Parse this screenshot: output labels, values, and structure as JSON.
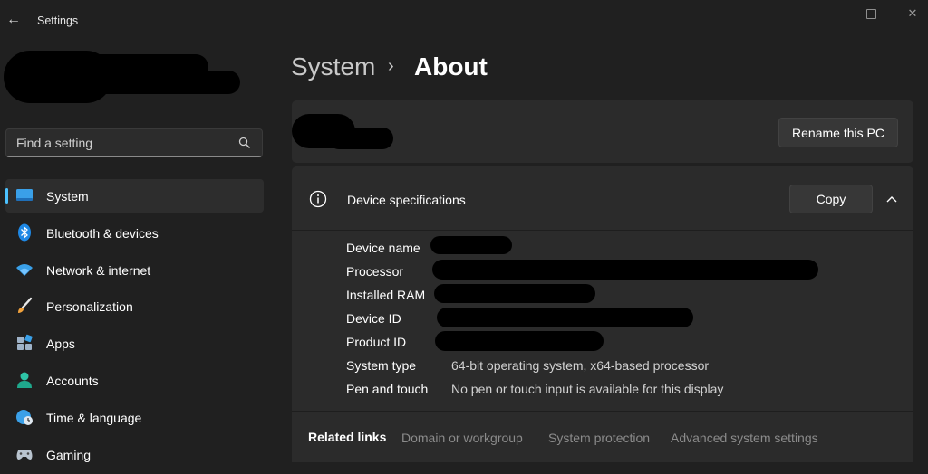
{
  "window": {
    "title": "Settings"
  },
  "search": {
    "placeholder": "Find a setting"
  },
  "sidebar": {
    "items": [
      {
        "label": "System",
        "icon": "monitor-icon",
        "active": true
      },
      {
        "label": "Bluetooth & devices",
        "icon": "bluetooth-icon"
      },
      {
        "label": "Network & internet",
        "icon": "wifi-icon"
      },
      {
        "label": "Personalization",
        "icon": "brush-icon"
      },
      {
        "label": "Apps",
        "icon": "apps-icon"
      },
      {
        "label": "Accounts",
        "icon": "person-icon"
      },
      {
        "label": "Time & language",
        "icon": "globe-clock-icon"
      },
      {
        "label": "Gaming",
        "icon": "gamepad-icon"
      }
    ]
  },
  "breadcrumb": {
    "parent": "System",
    "current": "About"
  },
  "pc_card": {
    "rename_label": "Rename this PC"
  },
  "specs": {
    "title": "Device specifications",
    "copy_label": "Copy",
    "rows": [
      {
        "label": "Device name",
        "value": ""
      },
      {
        "label": "Processor",
        "value": ""
      },
      {
        "label": "Installed RAM",
        "value": ""
      },
      {
        "label": "Device ID",
        "value": ""
      },
      {
        "label": "Product ID",
        "value": ""
      },
      {
        "label": "System type",
        "value": "64-bit operating system, x64-based processor"
      },
      {
        "label": "Pen and touch",
        "value": "No pen or touch input is available for this display"
      }
    ]
  },
  "related": {
    "title": "Related links",
    "links": [
      "Domain or workgroup",
      "System protection",
      "Advanced system settings"
    ]
  },
  "colors": {
    "accent": "#4cc2ff",
    "background": "#202020",
    "card": "#2b2b2b"
  }
}
